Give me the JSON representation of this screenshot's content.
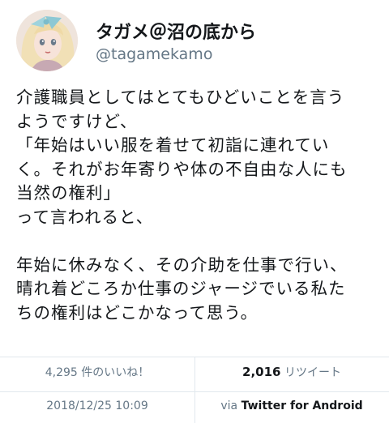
{
  "user": {
    "display_name": "タガメ＠沼の底から",
    "screen_name": "@tagamekamo"
  },
  "tweet": {
    "lines": [
      "介護職員としてはとてもひどいことを言う",
      "ようですけど、",
      "「年始はいい服を着せて初詣に連れてい",
      "く。それがお年寄りや体の不自由な人にも",
      "当然の権利」",
      "って言われると、",
      "",
      "年始に休みなく、その介助を仕事で行い、",
      "晴れ着どころか仕事のジャージでいる私た",
      "ちの権利はどこかなって思う。"
    ]
  },
  "stats": {
    "likes_text": "4,295 件のいいね！",
    "retweets_count": "2,016",
    "retweets_label": "リツイート"
  },
  "meta": {
    "timestamp": "2018/12/25 10:09",
    "via_label": "via",
    "source_app": "Twitter for Android"
  },
  "colors": {
    "text": "#14171a",
    "muted": "#657786",
    "divider": "#e1e8ed"
  },
  "icons": {
    "avatar": "doll-avatar"
  }
}
